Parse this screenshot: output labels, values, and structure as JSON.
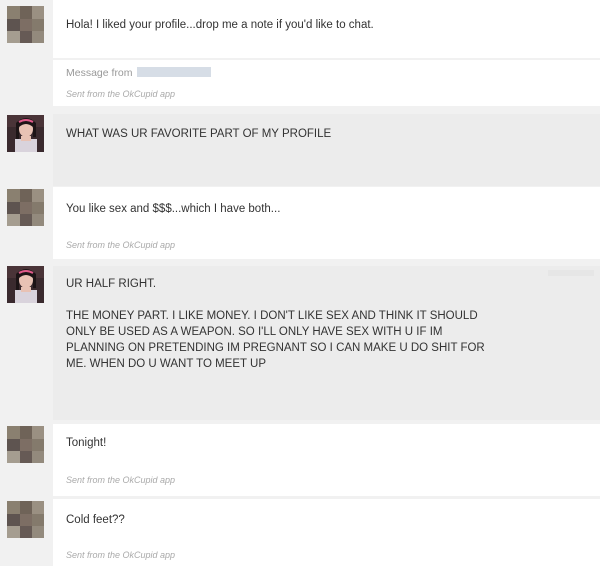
{
  "messages": [
    {
      "text": "Hola! I liked your profile...drop me a note if you'd like to chat."
    },
    {
      "text": "WHAT WAS UR FAVORITE PART OF MY PROFILE"
    },
    {
      "text": "You like sex and $$$...which I have both...",
      "sent": "Sent from the OkCupid app"
    },
    {
      "text": "UR HALF RIGHT.\n\nTHE MONEY PART. I LIKE MONEY. I DON'T LIKE SEX AND THINK IT SHOULD\nONLY BE USED AS A WEAPON. SO I'LL ONLY HAVE SEX WITH U IF IM\nPLANNING ON PRETENDING IM PREGNANT SO I CAN MAKE U DO SHIT FOR\nME. WHEN DO U WANT TO MEET UP"
    },
    {
      "text": "Tonight!",
      "sent": "Sent from the OkCupid app"
    },
    {
      "text": "Cold feet??",
      "sent": "Sent from the OkCupid app"
    }
  ],
  "first_footer": {
    "label": "Message from",
    "sent": "Sent from the OkCupid app"
  }
}
